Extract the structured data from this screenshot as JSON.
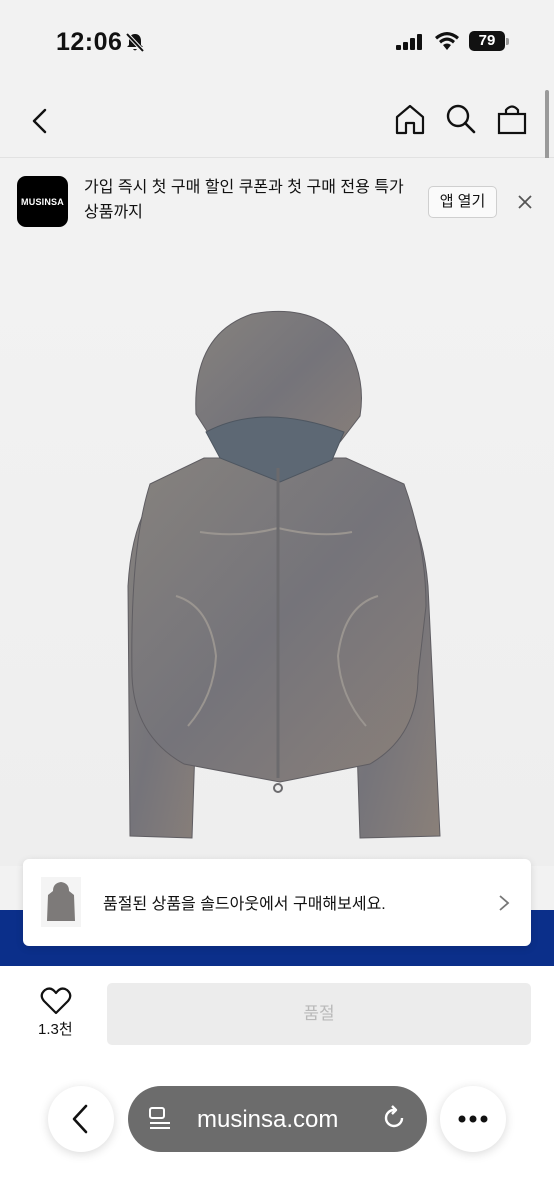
{
  "status_bar": {
    "time": "12:06",
    "battery": "79"
  },
  "promo_banner": {
    "logo_text": "MUSINSA",
    "message": "가입 즉시 첫 구매 할인 쿠폰과 첫 구매 전용 특가 상품까지",
    "open_app_label": "앱 열기"
  },
  "soldout_card": {
    "message": "품절된 상품을 솔드아웃에서 구매해보세요."
  },
  "bottom_bar": {
    "like_count": "1.3천",
    "soldout_label": "품절"
  },
  "browser": {
    "url": "musinsa.com"
  },
  "colors": {
    "banner_blue": "#0b2f8a",
    "garment": "#7d7a79"
  },
  "icons": [
    "bell-off-icon",
    "back-icon",
    "home-icon",
    "search-icon",
    "bag-icon",
    "close-icon",
    "chevron-right-icon",
    "heart-icon",
    "page-menu-icon",
    "reload-icon",
    "more-icon"
  ]
}
